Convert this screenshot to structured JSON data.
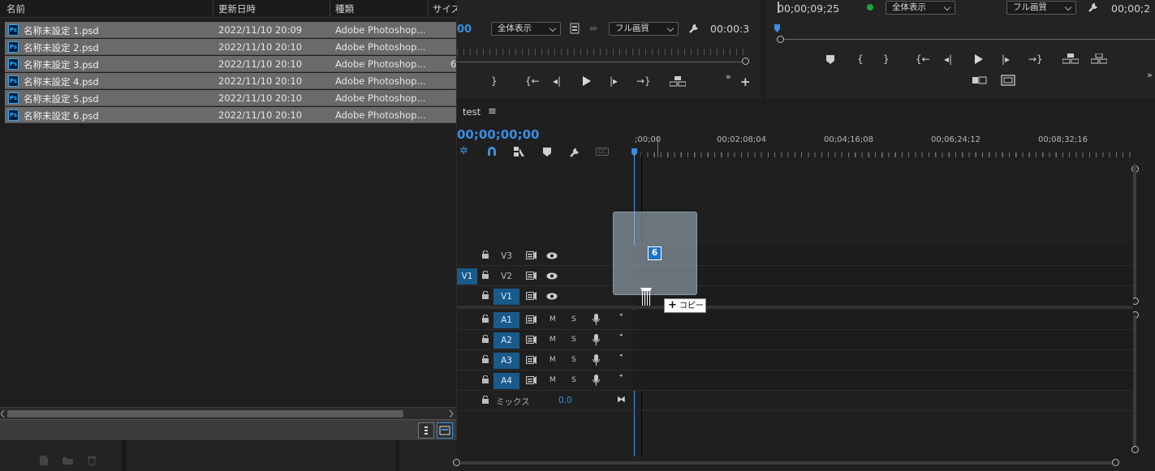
{
  "file_dialog": {
    "columns": {
      "name": "名前",
      "modified": "更新日時",
      "type": "種類",
      "size": "サイズ"
    },
    "files": [
      {
        "name": "名称未設定 1.psd",
        "modified": "2022/11/10 20:09",
        "type": "Adobe Photoshop...",
        "size": ""
      },
      {
        "name": "名称未設定 2.psd",
        "modified": "2022/11/10 20:10",
        "type": "Adobe Photoshop...",
        "size": ""
      },
      {
        "name": "名称未設定 3.psd",
        "modified": "2022/11/10 20:10",
        "type": "Adobe Photoshop...",
        "size": "6"
      },
      {
        "name": "名称未設定 4.psd",
        "modified": "2022/11/10 20:10",
        "type": "Adobe Photoshop...",
        "size": ""
      },
      {
        "name": "名称未設定 5.psd",
        "modified": "2022/11/10 20:10",
        "type": "Adobe Photoshop...",
        "size": ""
      },
      {
        "name": "名称未設定 6.psd",
        "modified": "2022/11/10 20:10",
        "type": "Adobe Photoshop...",
        "size": ""
      }
    ],
    "file_icon": "Ps"
  },
  "source_monitor": {
    "timecode": "00",
    "zoom": "全体表示",
    "quality": "フル画質",
    "duration": "00:00:3"
  },
  "program_monitor": {
    "timecode": "00;00;09;25",
    "zoom": "全体表示",
    "quality": "フル画質",
    "duration": "00;00;2"
  },
  "timeline": {
    "sequence_name": "test",
    "timecode": "00;00;00;00",
    "ruler_labels": [
      ";00;00",
      "00;02;08;04",
      "00;04;16;08",
      "00;06;24;12",
      "00;08;32;16"
    ],
    "video_tracks": [
      {
        "name": "V3",
        "targeted": false,
        "source": ""
      },
      {
        "name": "V2",
        "targeted": false,
        "source": "V1"
      },
      {
        "name": "V1",
        "targeted": true,
        "source": ""
      }
    ],
    "audio_tracks": [
      {
        "name": "A1",
        "mute": "M",
        "solo": "S"
      },
      {
        "name": "A2",
        "mute": "M",
        "solo": "S"
      },
      {
        "name": "A3",
        "mute": "M",
        "solo": "S"
      },
      {
        "name": "A4",
        "mute": "M",
        "solo": "S"
      }
    ],
    "mix_label": "ミックス",
    "mix_value": "0.0"
  },
  "drag": {
    "count": "6",
    "tooltip": "コピー"
  },
  "colors": {
    "accent": "#3b8fe0",
    "track_target": "#1a5a8a",
    "selected_row": "#6a6a6a"
  }
}
